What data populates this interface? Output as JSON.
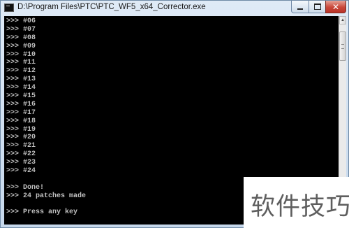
{
  "window": {
    "title": "D:\\Program Files\\PTC\\PTC_WF5_x64_Corrector.exe",
    "controls": {
      "minimize_glyph": "",
      "maximize_glyph": "",
      "close_glyph": "✕"
    }
  },
  "console": {
    "lines": [
      ">>> #06",
      ">>> #07",
      ">>> #08",
      ">>> #09",
      ">>> #10",
      ">>> #11",
      ">>> #12",
      ">>> #13",
      ">>> #14",
      ">>> #15",
      ">>> #16",
      ">>> #17",
      ">>> #18",
      ">>> #19",
      ">>> #20",
      ">>> #21",
      ">>> #22",
      ">>> #23",
      ">>> #24",
      "",
      ">>> Done!",
      ">>> 24 patches made",
      "",
      ">>> Press any key"
    ],
    "text_color": "#c0c0c0",
    "background": "#000000"
  },
  "scrollbar": {
    "up_arrow": "▲",
    "down_arrow": "▼"
  },
  "watermark": {
    "text": "软件技巧"
  },
  "icons": [
    "console-app-icon",
    "minimize-icon",
    "maximize-icon",
    "close-icon",
    "scroll-up-icon",
    "scroll-down-icon"
  ]
}
